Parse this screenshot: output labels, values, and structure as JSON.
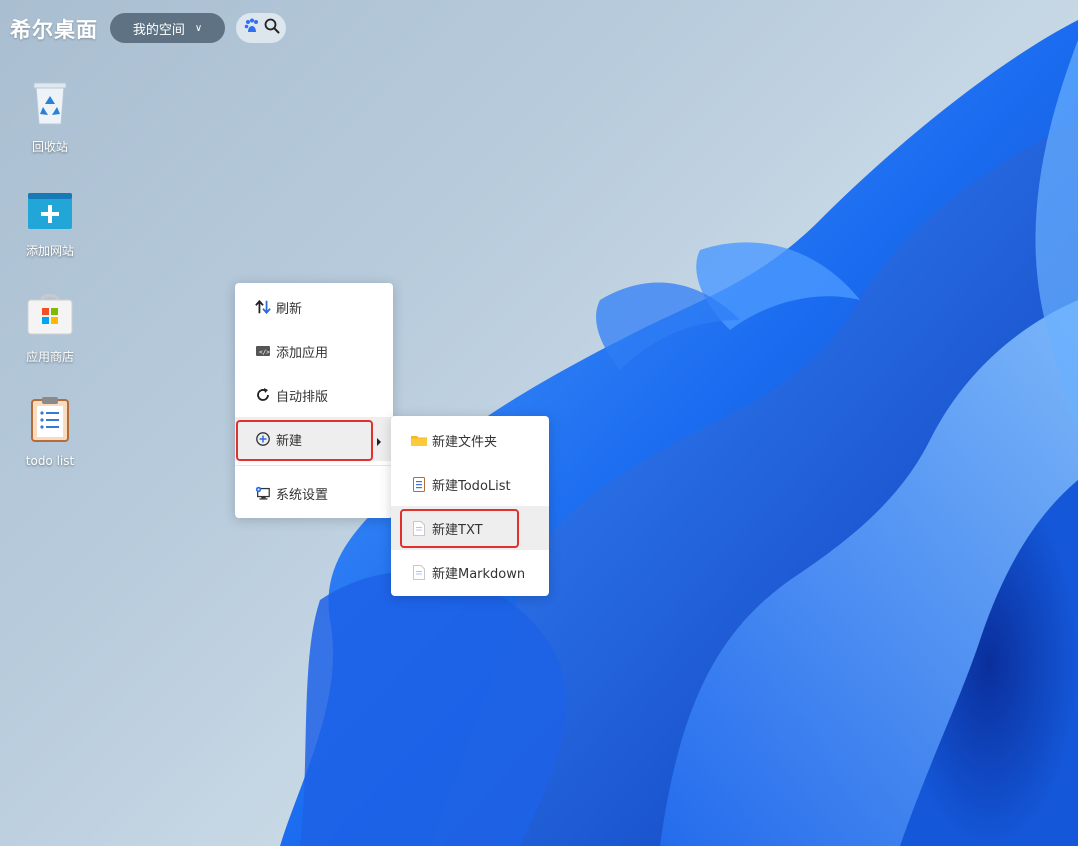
{
  "app": {
    "brand": "希尔桌面"
  },
  "topbar": {
    "space_label": "我的空间",
    "space_chevron": "∨",
    "search_icons": [
      "baidu-paw-icon",
      "search-icon"
    ]
  },
  "desktop_icons": [
    {
      "label": "回收站",
      "icon": "recycle-bin-icon"
    },
    {
      "label": "添加网站",
      "icon": "add-website-icon"
    },
    {
      "label": "应用商店",
      "icon": "app-store-icon"
    },
    {
      "label": "todo list",
      "icon": "todo-list-icon"
    }
  ],
  "context_menu": {
    "items": [
      {
        "label": "刷新",
        "icon": "refresh-arrows-icon"
      },
      {
        "label": "添加应用",
        "icon": "add-app-icon"
      },
      {
        "label": "自动排版",
        "icon": "auto-arrange-icon"
      },
      {
        "label": "新建",
        "icon": "new-plus-circle-icon",
        "has_submenu": true,
        "highlighted": true
      },
      {
        "label": "系统设置",
        "icon": "system-settings-icon"
      }
    ]
  },
  "submenu": {
    "items": [
      {
        "label": "新建文件夹",
        "icon": "folder-icon"
      },
      {
        "label": "新建TodoList",
        "icon": "todolist-file-icon"
      },
      {
        "label": "新建TXT",
        "icon": "txt-file-icon",
        "highlighted": true
      },
      {
        "label": "新建Markdown",
        "icon": "markdown-file-icon"
      }
    ]
  },
  "colors": {
    "highlight_border": "#e0312c",
    "wallpaper_blue": "#1565e8",
    "topbar_pill": "#5e7283"
  }
}
